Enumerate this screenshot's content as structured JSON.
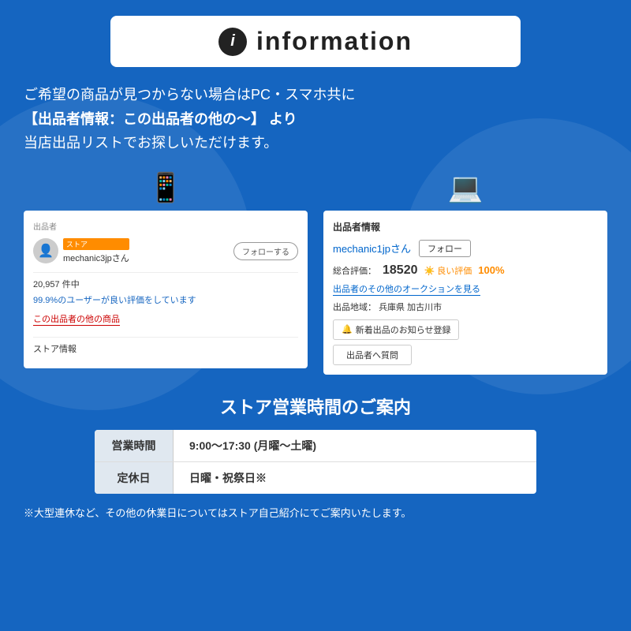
{
  "background_color": "#1565c0",
  "header": {
    "icon_symbol": "i",
    "title": "information"
  },
  "main_text_lines": [
    "ご希望の商品が見つからない場合はPC・スマホ共に",
    "【出品者情報：この出品者の他の〜】 より",
    "当店出品リストでお探しいただけます。"
  ],
  "left_screenshot": {
    "section_label": "出品者",
    "store_badge": "ストア",
    "seller_name": "mechanic3jpさん",
    "follow_button": "フォローする",
    "count_text": "20,957 件中",
    "rating_text": "99.9%のユーザーが良い評価をしています",
    "other_products_link": "この出品者の他の商品",
    "store_info_link": "ストア情報"
  },
  "right_screenshot": {
    "title": "出品者情報",
    "seller_name": "mechanic1jpさん",
    "follow_button": "フォロー",
    "rating_label": "総合評価：",
    "rating_number": "18520",
    "good_label": "良い評価",
    "good_percent": "100%",
    "auction_link": "出品者のその他のオークションを見る",
    "location_label": "出品地域：",
    "location_value": "兵庫県 加古川市",
    "notification_button": "新着出品のお知らせ登録",
    "question_button": "出品者へ質問"
  },
  "phone_icon": "📱",
  "pc_icon": "💻",
  "hours_section": {
    "title": "ストア営業時間のご案内",
    "rows": [
      {
        "label": "営業時間",
        "value": "9:00〜17:30 (月曜〜土曜)"
      },
      {
        "label": "定休日",
        "value": "日曜・祝祭日※"
      }
    ],
    "note": "※大型連休など、その他の休業日についてはストア自己紹介にてご案内いたします。"
  }
}
